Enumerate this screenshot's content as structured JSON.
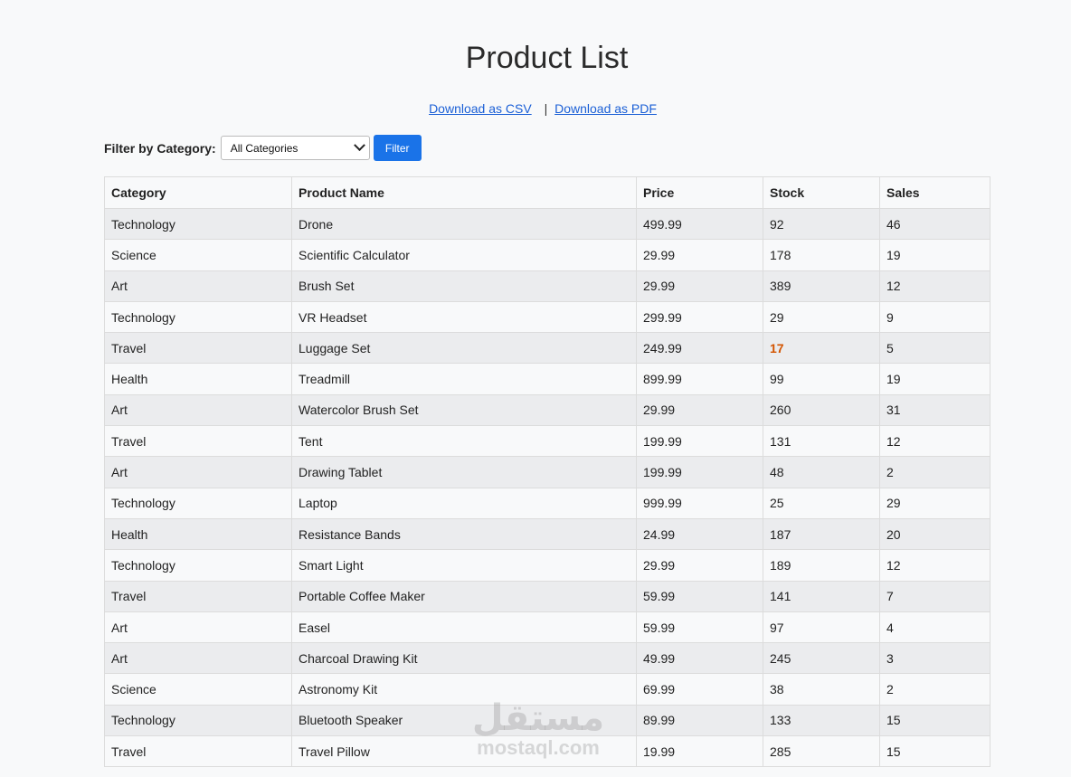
{
  "page": {
    "title": "Product List",
    "download_csv": "Download as CSV",
    "separator": "|",
    "download_pdf": "Download as PDF"
  },
  "filter": {
    "label": "Filter by Category:",
    "selected": "All Categories",
    "button": "Filter"
  },
  "table": {
    "headers": [
      "Category",
      "Product Name",
      "Price",
      "Stock",
      "Sales"
    ],
    "rows": [
      [
        "Technology",
        "Drone",
        "499.99",
        "92",
        "46"
      ],
      [
        "Science",
        "Scientific Calculator",
        "29.99",
        "178",
        "19"
      ],
      [
        "Art",
        "Brush Set",
        "29.99",
        "389",
        "12"
      ],
      [
        "Technology",
        "VR Headset",
        "299.99",
        "29",
        "9"
      ],
      [
        "Travel",
        "Luggage Set",
        "249.99",
        "17",
        "5"
      ],
      [
        "Health",
        "Treadmill",
        "899.99",
        "99",
        "19"
      ],
      [
        "Art",
        "Watercolor Brush Set",
        "29.99",
        "260",
        "31"
      ],
      [
        "Travel",
        "Tent",
        "199.99",
        "131",
        "12"
      ],
      [
        "Art",
        "Drawing Tablet",
        "199.99",
        "48",
        "2"
      ],
      [
        "Technology",
        "Laptop",
        "999.99",
        "25",
        "29"
      ],
      [
        "Health",
        "Resistance Bands",
        "24.99",
        "187",
        "20"
      ],
      [
        "Technology",
        "Smart Light",
        "29.99",
        "189",
        "12"
      ],
      [
        "Travel",
        "Portable Coffee Maker",
        "59.99",
        "141",
        "7"
      ],
      [
        "Art",
        "Easel",
        "59.99",
        "97",
        "4"
      ],
      [
        "Art",
        "Charcoal Drawing Kit",
        "49.99",
        "245",
        "3"
      ],
      [
        "Science",
        "Astronomy Kit",
        "69.99",
        "38",
        "2"
      ],
      [
        "Technology",
        "Bluetooth Speaker",
        "89.99",
        "133",
        "15"
      ],
      [
        "Travel",
        "Travel Pillow",
        "19.99",
        "285",
        "15"
      ]
    ],
    "low_stock_color": "#d35400"
  },
  "watermark": {
    "arabic": "مستقل",
    "latin": "mostaql.com"
  },
  "colors": {
    "link": "#1a5fd6",
    "button": "#1a73e8",
    "background": "#f8f9fa",
    "row_alt": "#ebecee"
  }
}
